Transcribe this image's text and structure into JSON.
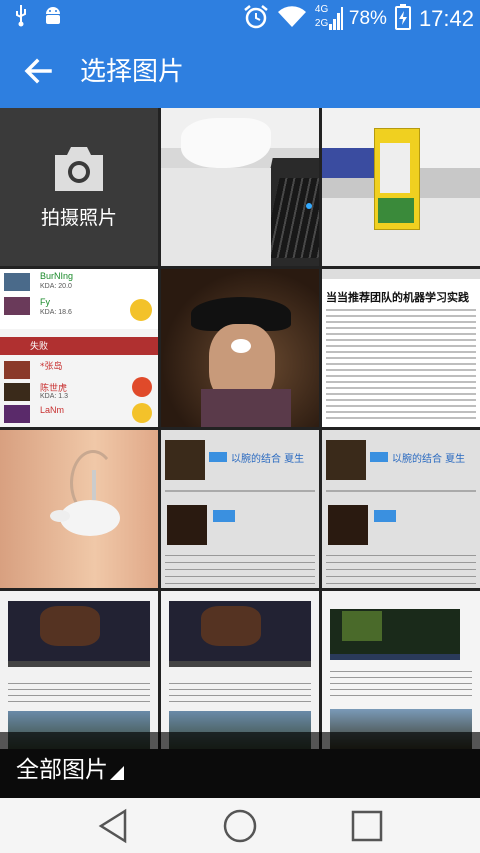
{
  "status_bar": {
    "network_4g": "4G",
    "network_2g": "2G",
    "battery": "78%",
    "time": "17:42",
    "icons": [
      "usb-icon",
      "android-debug-icon",
      "alarm-icon",
      "wifi-icon",
      "signal-icon",
      "battery-charging-icon"
    ]
  },
  "app_bar": {
    "title": "选择图片",
    "back_icon": "arrow-back-icon"
  },
  "grid": {
    "camera_label": "拍摄照片",
    "photos": [
      {
        "type": "keyboard-desk"
      },
      {
        "type": "juice-box"
      },
      {
        "type": "game-stats",
        "entries": [
          {
            "name": "BurNIng",
            "stat": "KDA: 20.0"
          },
          {
            "name": "Fy",
            "stat": "KDA: 18.6"
          },
          {
            "name": "失败",
            "stat": ""
          },
          {
            "name": "*张岛",
            "stat": ""
          },
          {
            "name": "陈世虎",
            "stat": "KDA: 1.3"
          },
          {
            "name": "LaNm",
            "stat": ""
          }
        ]
      },
      {
        "type": "child-hat"
      },
      {
        "type": "article",
        "headline": "当当推荐团队的机器学习实践"
      },
      {
        "type": "earring"
      },
      {
        "type": "webpage-photo",
        "badge": "以腕的结合 夏生"
      },
      {
        "type": "webpage-photo",
        "badge": "以腕的结合 夏生"
      },
      {
        "type": "video-article"
      },
      {
        "type": "video-article"
      },
      {
        "type": "video-article"
      }
    ]
  },
  "bottom_bar": {
    "folder_label": "全部图片"
  },
  "nav_bar": {
    "back": "nav-back-icon",
    "home": "nav-home-icon",
    "recents": "nav-recents-icon"
  }
}
